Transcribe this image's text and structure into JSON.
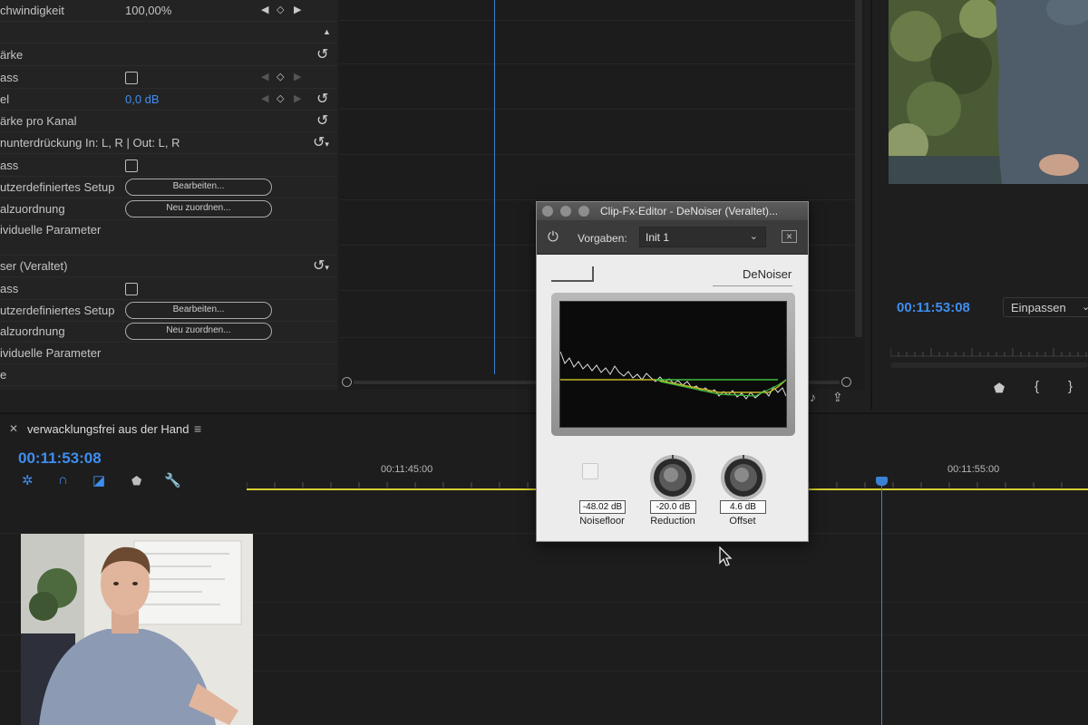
{
  "effect_controls": {
    "rows": [
      {
        "label": "chwindigkeit",
        "value": "100,00%"
      },
      {
        "label": "ärke"
      },
      {
        "label": "ass"
      },
      {
        "label": "el",
        "value": "0,0 dB"
      },
      {
        "label": "ärke pro Kanal"
      },
      {
        "label": "nunterdrückung In: L, R | Out: L, R"
      },
      {
        "label": "ass"
      },
      {
        "label": "utzerdefiniertes Setup",
        "button": "Bearbeiten..."
      },
      {
        "label": "alzuordnung",
        "button": "Neu zuordnen..."
      },
      {
        "label": "ividuelle Parameter"
      },
      {
        "label": "ser (Veraltet)"
      },
      {
        "label": "ass"
      },
      {
        "label": "utzerdefiniertes Setup",
        "button": "Bearbeiten..."
      },
      {
        "label": "alzuordnung",
        "button": "Neu zuordnen..."
      },
      {
        "label": "ividuelle Parameter"
      },
      {
        "label": "e"
      }
    ]
  },
  "program_monitor": {
    "timecode": "00:11:53:08",
    "fit_dropdown": "Einpassen"
  },
  "timeline": {
    "sequence_name": "verwacklungsfrei aus der Hand",
    "timecode": "00:11:53:08",
    "ruler": [
      "00:11:45:00",
      "00:11:55:00"
    ]
  },
  "denoiser": {
    "window_title": "Clip-Fx-Editor - DeNoiser (Veraltet)...",
    "preset_label": "Vorgaben:",
    "preset_value": "Init 1",
    "brand": "DeNoiser",
    "noisefloor": {
      "value": "-48.02 dB",
      "label": "Noisefloor"
    },
    "reduction": {
      "value": "-20.0 dB",
      "label": "Reduction"
    },
    "offset": {
      "value": "4.6 dB",
      "label": "Offset"
    }
  },
  "colors": {
    "accent_blue": "#3e8ef0",
    "timeline_yellow": "#d8cf32",
    "spectrum_green": "#3cbf3c"
  }
}
